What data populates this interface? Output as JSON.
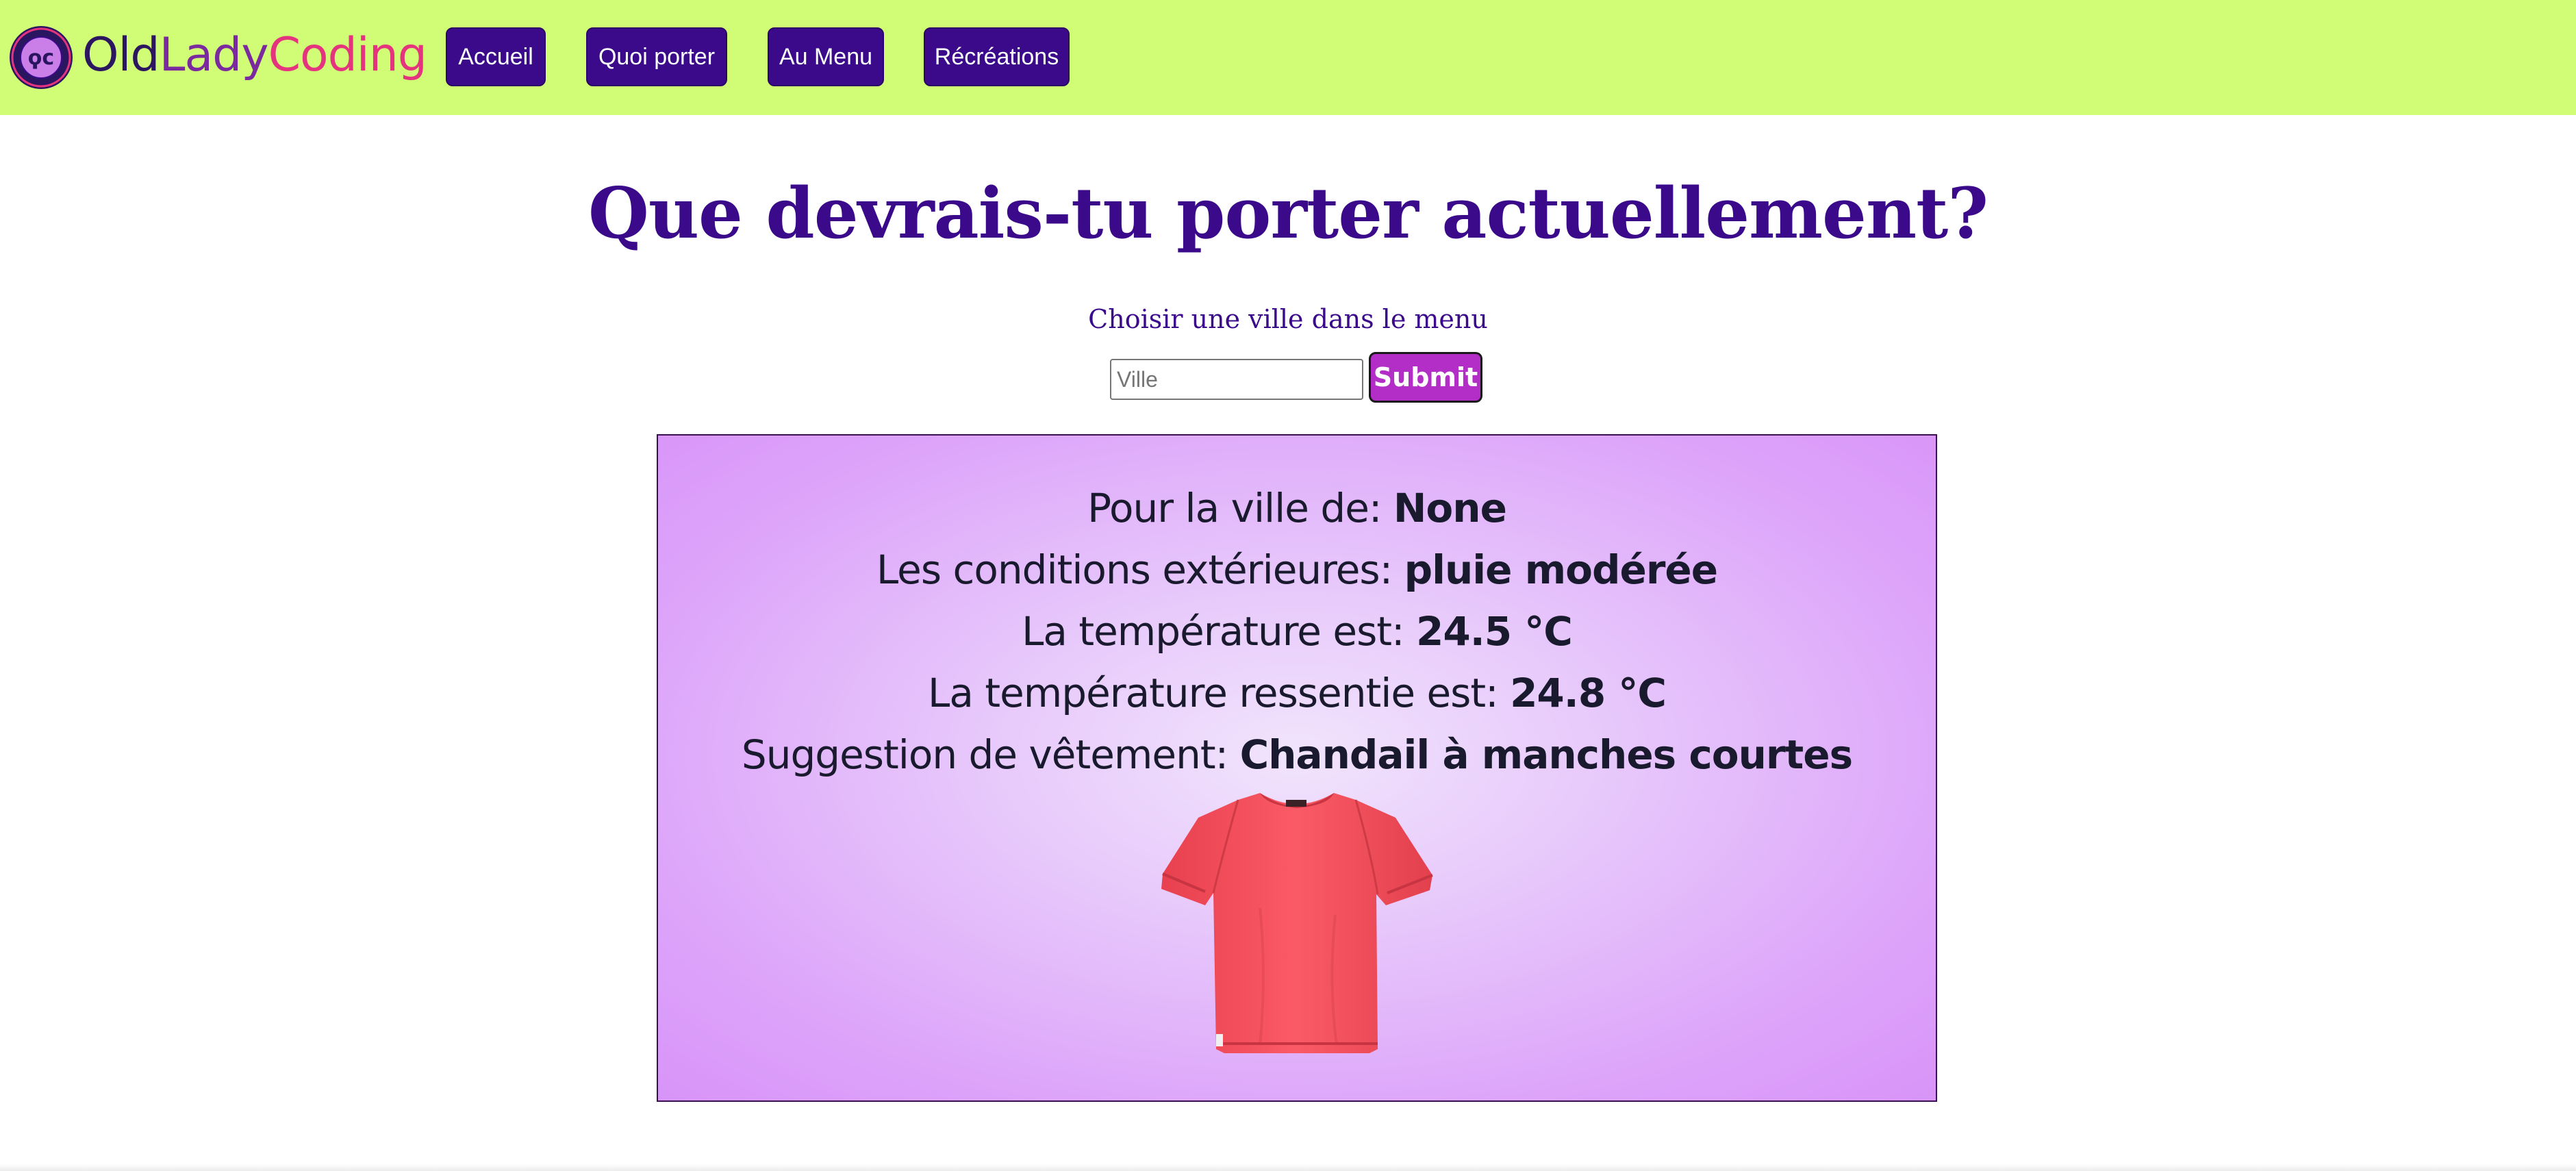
{
  "header": {
    "brand": {
      "part1": "Old",
      "part2": "Lady",
      "part3": "Coding"
    },
    "nav": [
      {
        "label": "Accueil"
      },
      {
        "label": "Quoi porter"
      },
      {
        "label": "Au Menu"
      },
      {
        "label": "Récréations"
      }
    ]
  },
  "main": {
    "title": "Que devrais-tu porter actuellement?",
    "choose_label": "Choisir une ville dans le menu",
    "city_placeholder": "Ville",
    "submit_label": "Submit"
  },
  "weather": {
    "city_label": "Pour la ville de: ",
    "city_value": "None",
    "conditions_label": "Les conditions extérieures: ",
    "conditions_value": "pluie modérée",
    "temp_label": "La température est: ",
    "temp_value": "24.5 °C",
    "feels_label": "La température ressentie est: ",
    "feels_value": "24.8 °C",
    "suggestion_label": "Suggestion de vêtement: ",
    "suggestion_value": "Chandail à manches courtes"
  },
  "colors": {
    "nav_bg": "#d1fd76",
    "nav_button": "#3a0a8a",
    "title": "#3a0a8a",
    "submit": "#b32ec7",
    "card": "#dda4fa",
    "tshirt": "#f4535f"
  },
  "icons": {
    "logo": "old-lady-coding-badge",
    "garment": "t-shirt-image"
  }
}
